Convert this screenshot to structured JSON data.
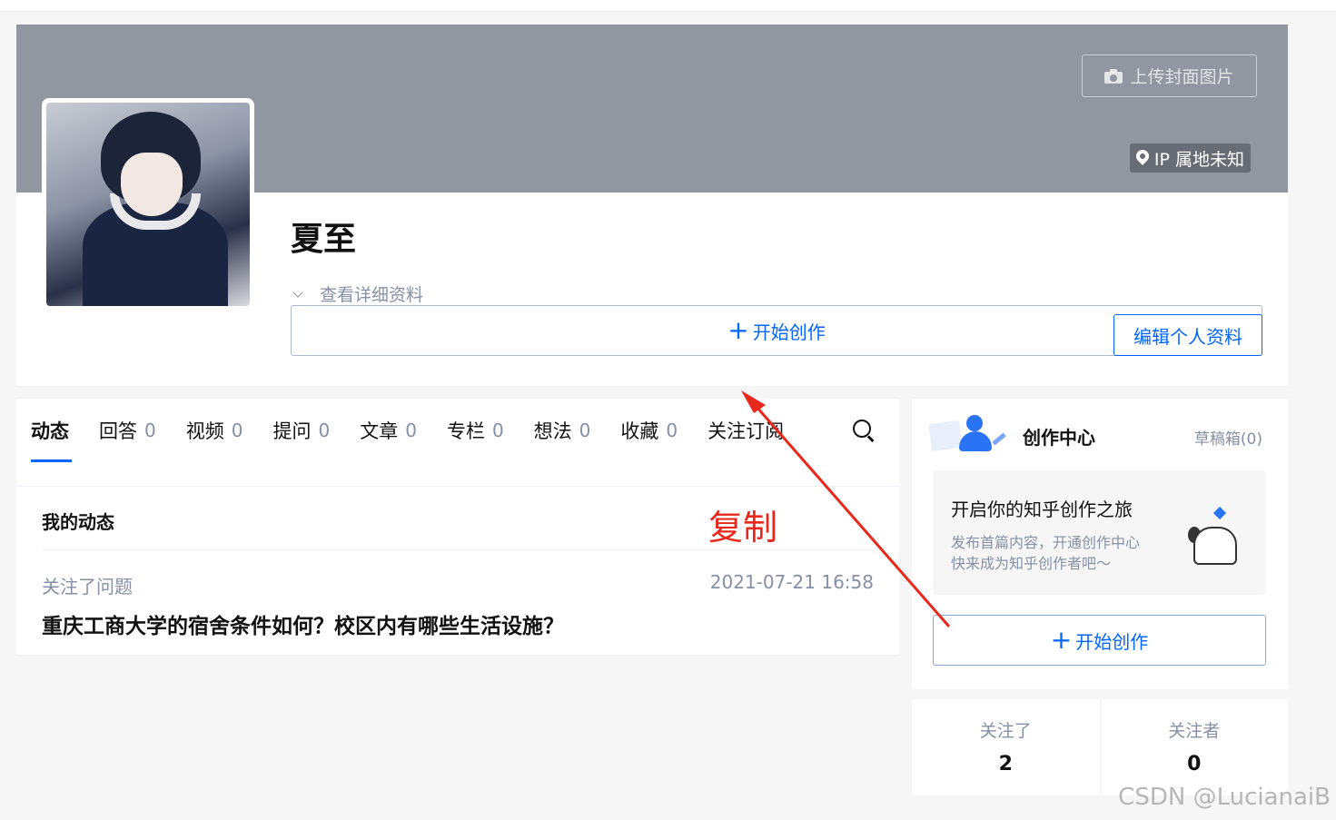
{
  "cover": {
    "upload_label": "上传封面图片",
    "ip_label": "IP 属地未知"
  },
  "profile": {
    "name": "夏至",
    "detail_toggle": "查看详细资料",
    "start_create_label": "开始创作",
    "edit_profile_label": "编辑个人资料"
  },
  "tabs": [
    {
      "label": "动态",
      "count": ""
    },
    {
      "label": "回答",
      "count": "0"
    },
    {
      "label": "视频",
      "count": "0"
    },
    {
      "label": "提问",
      "count": "0"
    },
    {
      "label": "文章",
      "count": "0"
    },
    {
      "label": "专栏",
      "count": "0"
    },
    {
      "label": "想法",
      "count": "0"
    },
    {
      "label": "收藏",
      "count": "0"
    },
    {
      "label": "关注订阅",
      "count": ""
    }
  ],
  "feed": {
    "section_title": "我的动态",
    "activity_type": "关注了问题",
    "activity_time": "2021-07-21 16:58",
    "activity_title": "重庆工商大学的宿舍条件如何？校区内有哪些生活设施？"
  },
  "creation_center": {
    "title": "创作中心",
    "drafts": "草稿箱(0)",
    "journey_title": "开启你的知乎创作之旅",
    "journey_desc_1": "发布首篇内容，开通创作中心",
    "journey_desc_2": "快来成为知乎创作者吧～",
    "start_create_label": "开始创作"
  },
  "stats": {
    "following_label": "关注了",
    "following_value": "2",
    "followers_label": "关注者",
    "followers_value": "0"
  },
  "annotation": {
    "label": "复制",
    "color": "#e8281c"
  },
  "watermark": "CSDN @LucianaiB",
  "colors": {
    "accent": "#0066ff",
    "cover": "#9196a1",
    "muted": "#8590a6"
  }
}
